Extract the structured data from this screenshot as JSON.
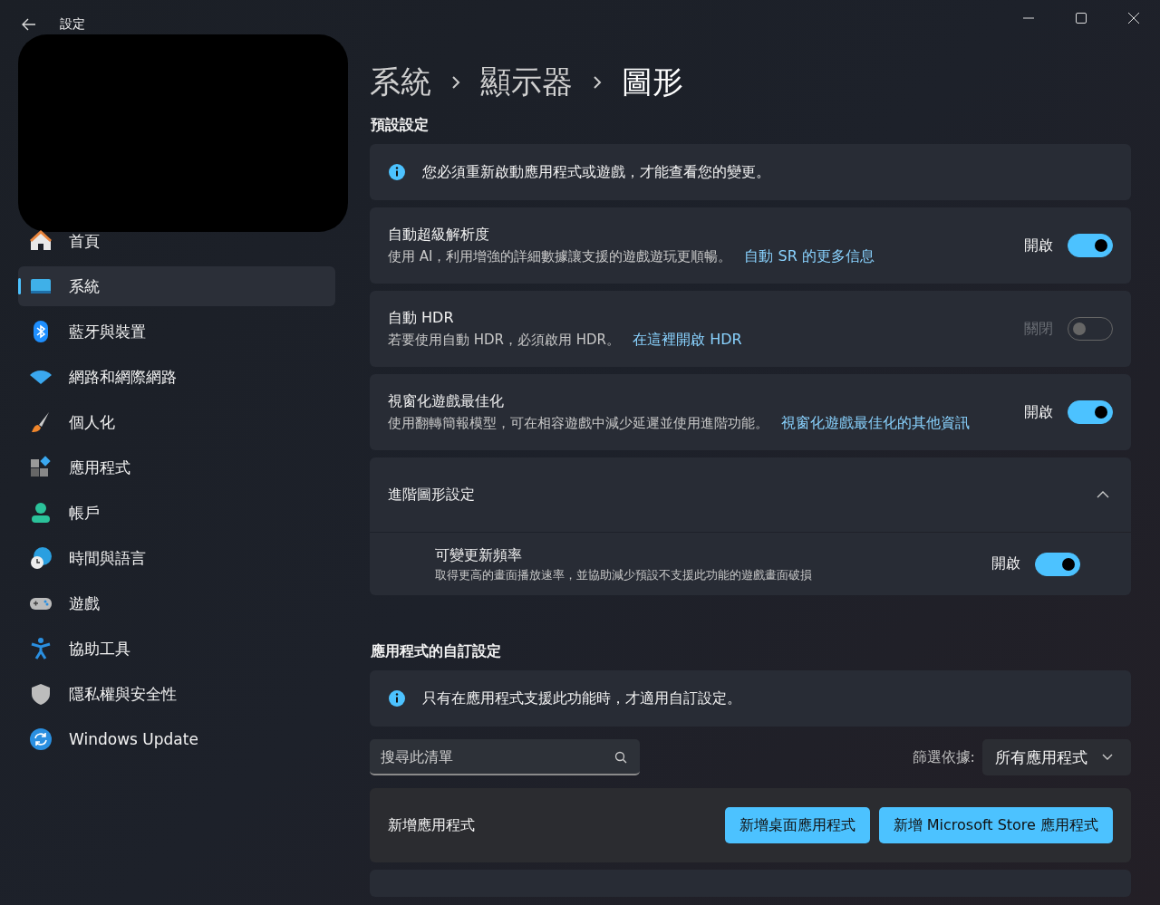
{
  "window": {
    "title": "設定"
  },
  "sidebar": {
    "items": [
      {
        "label": "首頁",
        "kind": "home",
        "selected": false
      },
      {
        "label": "系統",
        "kind": "monitor",
        "selected": true
      },
      {
        "label": "藍牙與裝置",
        "kind": "bluetooth",
        "selected": false
      },
      {
        "label": "網路和網際網路",
        "kind": "wifi",
        "selected": false
      },
      {
        "label": "個人化",
        "kind": "brush",
        "selected": false
      },
      {
        "label": "應用程式",
        "kind": "apps",
        "selected": false
      },
      {
        "label": "帳戶",
        "kind": "person",
        "selected": false
      },
      {
        "label": "時間與語言",
        "kind": "globe",
        "selected": false
      },
      {
        "label": "遊戲",
        "kind": "gamepad",
        "selected": false
      },
      {
        "label": "協助工具",
        "kind": "accessibility",
        "selected": false
      },
      {
        "label": "隱私權與安全性",
        "kind": "shield",
        "selected": false
      },
      {
        "label": "Windows Update",
        "kind": "update",
        "selected": false
      }
    ]
  },
  "breadcrumb": [
    "系統",
    "顯示器",
    "圖形"
  ],
  "defaults": {
    "heading": "預設設定",
    "info": "您必須重新啟動應用程式或遊戲，才能查看您的變更。",
    "settings": [
      {
        "title": "自動超級解析度",
        "description": "使用 AI，利用增強的詳細數據讓支援的遊戲遊玩更順暢。",
        "link": "自動 SR 的更多信息",
        "state_label": "開啟",
        "on": true,
        "disabled": false
      },
      {
        "title": "自動 HDR",
        "description": "若要使用自動 HDR，必須啟用 HDR。",
        "link": "在這裡開啟 HDR",
        "state_label": "關閉",
        "on": false,
        "disabled": true
      },
      {
        "title": "視窗化遊戲最佳化",
        "description": "使用翻轉簡報模型，可在相容遊戲中減少延遲並使用進階功能。",
        "link": "視窗化遊戲最佳化的其他資訊",
        "state_label": "開啟",
        "on": true,
        "disabled": false
      }
    ],
    "advanced": {
      "title": "進階圖形設定",
      "expanded": true,
      "children": [
        {
          "title": "可變更新頻率",
          "description": "取得更高的畫面播放速率，並協助減少預設不支援此功能的遊戲畫面破損",
          "state_label": "開啟",
          "on": true
        }
      ]
    }
  },
  "apps": {
    "heading": "應用程式的自訂設定",
    "info": "只有在應用程式支援此功能時，才適用自訂設定。",
    "search": {
      "placeholder": "搜尋此清單"
    },
    "filter": {
      "label": "篩選依據:",
      "value": "所有應用程式"
    },
    "add": {
      "label": "新增應用程式",
      "buttons": [
        "新增桌面應用程式",
        "新增 Microsoft Store 應用程式"
      ]
    }
  }
}
